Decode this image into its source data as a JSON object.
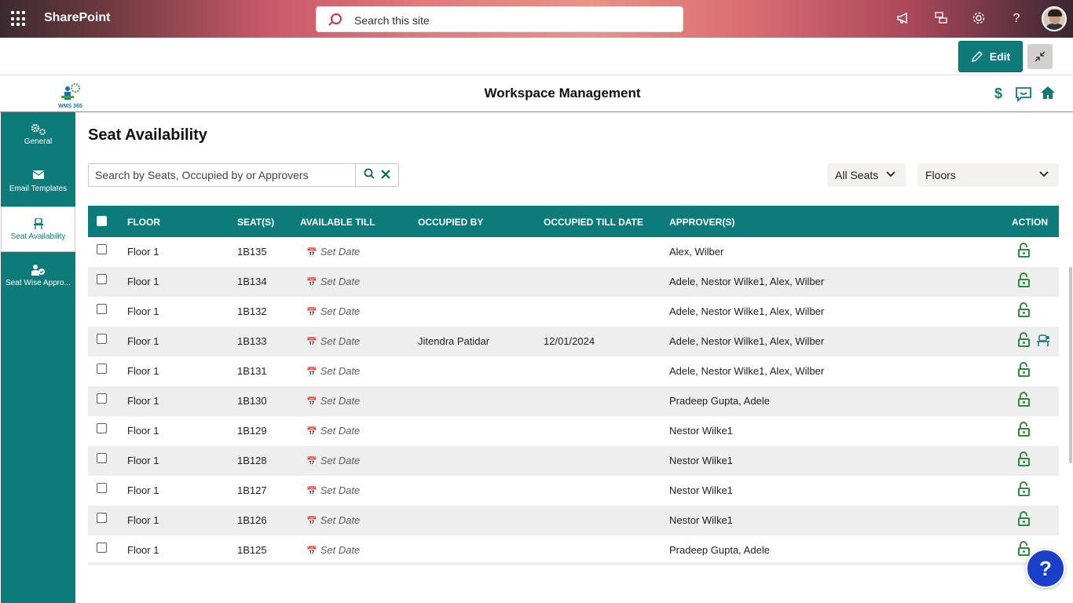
{
  "suitebar": {
    "brand": "SharePoint",
    "search_placeholder": "Search this site",
    "icons": [
      "waffle-icon",
      "megaphone-icon",
      "chat-icon",
      "gear-icon",
      "help-icon",
      "avatar"
    ]
  },
  "command": {
    "edit_label": "Edit"
  },
  "app": {
    "logo_text": "WMS 365",
    "title": "Workspace Management"
  },
  "nav": {
    "items": [
      {
        "label": "General",
        "icon": "gears-icon"
      },
      {
        "label": "Email Templates",
        "icon": "envelope-icon"
      },
      {
        "label": "Seat Availability",
        "icon": "chair-icon"
      },
      {
        "label": "Seat Wise Appro...",
        "icon": "person-approve-icon"
      }
    ]
  },
  "main": {
    "title": "Seat Availability",
    "search_placeholder": "Search by Seats, Occupied by or Approvers",
    "filter_seats": "All Seats",
    "filter_floors": "Floors"
  },
  "table": {
    "headers": {
      "floor": "FLOOR",
      "seats": "SEAT(S)",
      "available_till": "AVAILABLE TILL",
      "occupied_by": "OCCUPIED BY",
      "occupied_till": "OCCUPIED TILL DATE",
      "approvers": "APPROVER(S)",
      "action": "ACTION"
    },
    "rows": [
      {
        "floor": "Floor 1",
        "seat": "1B135",
        "available": "Set Date",
        "occupied_by": "",
        "occupied_till": "",
        "approvers": "Alex, Wilber"
      },
      {
        "floor": "Floor 1",
        "seat": "1B134",
        "available": "Set Date",
        "occupied_by": "",
        "occupied_till": "",
        "approvers": "Adele, Nestor Wilke1, Alex, Wilber"
      },
      {
        "floor": "Floor 1",
        "seat": "1B132",
        "available": "Set Date",
        "occupied_by": "",
        "occupied_till": "",
        "approvers": "Adele, Nestor Wilke1, Alex, Wilber"
      },
      {
        "floor": "Floor 1",
        "seat": "1B133",
        "available": "Set Date",
        "occupied_by": "Jitendra Patidar",
        "occupied_till": "12/01/2024",
        "approvers": "Adele, Nestor Wilke1, Alex, Wilber"
      },
      {
        "floor": "Floor 1",
        "seat": "1B131",
        "available": "Set Date",
        "occupied_by": "",
        "occupied_till": "",
        "approvers": "Adele, Nestor Wilke1, Alex, Wilber"
      },
      {
        "floor": "Floor 1",
        "seat": "1B130",
        "available": "Set Date",
        "occupied_by": "",
        "occupied_till": "",
        "approvers": "Pradeep Gupta, Adele"
      },
      {
        "floor": "Floor 1",
        "seat": "1B129",
        "available": "Set Date",
        "occupied_by": "",
        "occupied_till": "",
        "approvers": "Nestor Wilke1"
      },
      {
        "floor": "Floor 1",
        "seat": "1B128",
        "available": "Set Date",
        "occupied_by": "",
        "occupied_till": "",
        "approvers": "Nestor Wilke1"
      },
      {
        "floor": "Floor 1",
        "seat": "1B127",
        "available": "Set Date",
        "occupied_by": "",
        "occupied_till": "",
        "approvers": "Nestor Wilke1"
      },
      {
        "floor": "Floor 1",
        "seat": "1B126",
        "available": "Set Date",
        "occupied_by": "",
        "occupied_till": "",
        "approvers": "Nestor Wilke1"
      },
      {
        "floor": "Floor 1",
        "seat": "1B125",
        "available": "Set Date",
        "occupied_by": "",
        "occupied_till": "",
        "approvers": "Pradeep Gupta, Adele"
      }
    ]
  },
  "help": "?",
  "colors": {
    "accent": "#0c7b7a",
    "lock_green": "#2e8b3d",
    "help_blue": "#1a3fc9"
  }
}
